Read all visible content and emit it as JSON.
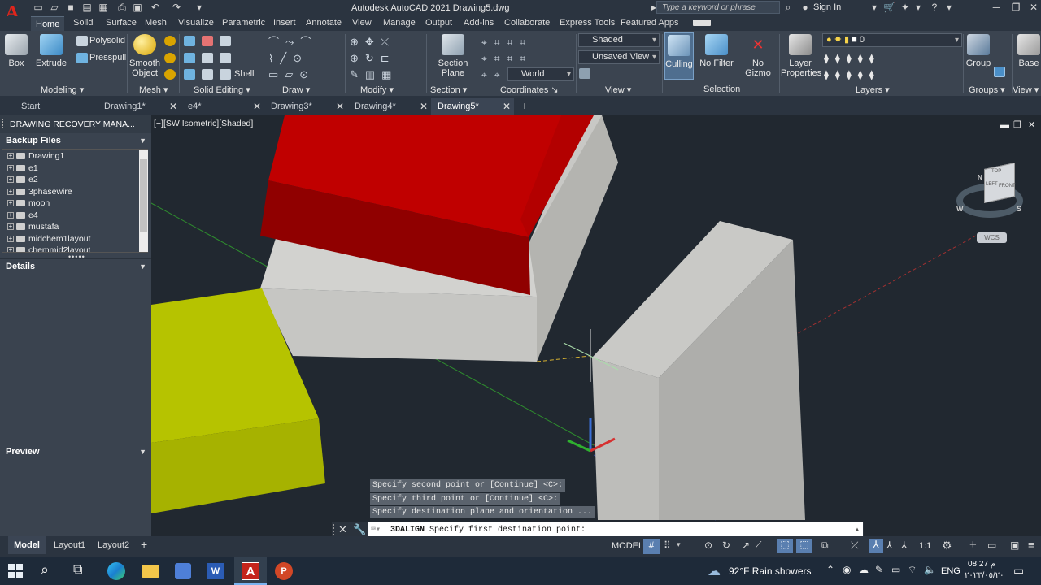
{
  "colors": {
    "accent": "#e0251c",
    "viewport_bg": "#212830",
    "ribbon_bg": "#3b4450",
    "red_box": "#b00000",
    "yellow_box": "#b5bf00",
    "grey_box": "#c5c5c2"
  },
  "titlebar": {
    "title": "Autodesk AutoCAD 2021    Drawing5.dwg",
    "search_placeholder": "Type a keyword or phrase",
    "sign_in": "Sign In"
  },
  "ribbon_tabs": [
    "Home",
    "Solid",
    "Surface",
    "Mesh",
    "Visualize",
    "Parametric",
    "Insert",
    "Annotate",
    "View",
    "Manage",
    "Output",
    "Add-ins",
    "Collaborate",
    "Express Tools",
    "Featured Apps"
  ],
  "ribbon": {
    "box": "Box",
    "extrude": "Extrude",
    "polysolid": "Polysolid",
    "presspull": "Presspull",
    "smooth_object_1": "Smooth",
    "smooth_object_2": "Object",
    "shell": "Shell",
    "section_plane_1": "Section",
    "section_plane_2": "Plane",
    "visual_style": "Shaded",
    "view_state": "Unsaved View",
    "ucs": "World",
    "culling": "Culling",
    "no_filter": "No Filter",
    "no_gizmo_1": "No",
    "no_gizmo_2": "Gizmo",
    "layer_properties_1": "Layer",
    "layer_properties_2": "Properties",
    "layer_value": "0",
    "group": "Group",
    "base": "Base",
    "panels": {
      "modeling": "Modeling",
      "mesh": "Mesh",
      "solid_editing": "Solid Editing",
      "draw": "Draw",
      "modify": "Modify",
      "section": "Section",
      "coordinates": "Coordinates",
      "view": "View",
      "selection": "Selection",
      "layers": "Layers",
      "groups": "Groups",
      "view2": "View"
    }
  },
  "doc_tabs": [
    {
      "label": "Start"
    },
    {
      "label": "Drawing1*"
    },
    {
      "label": "e4*"
    },
    {
      "label": "Drawing3*"
    },
    {
      "label": "Drawing4*"
    },
    {
      "label": "Drawing5*"
    }
  ],
  "palette": {
    "title": "DRAWING RECOVERY MANA...",
    "backup_files": "Backup Files",
    "files": [
      "Drawing1",
      "e1",
      "e2",
      "3phasewire",
      "moon",
      "e4",
      "mustafa",
      "midchem1layout",
      "chemmid2layout"
    ],
    "details": "Details",
    "preview": "Preview"
  },
  "viewport": {
    "label": "[−][SW Isometric][Shaded]",
    "viewcube": {
      "top": "TOP",
      "left": "LEFT",
      "front": "FRONT",
      "w": "W",
      "s": "S",
      "n": "N",
      "wcs": "WCS"
    }
  },
  "command": {
    "history": [
      "Specify second point or [Continue] <C>:",
      "Specify third point or [Continue] <C>:",
      " Specify destination plane and orientation ..."
    ],
    "current_cmd": "3DALIGN",
    "current_prompt": "Specify first destination point:"
  },
  "statusbar": {
    "layout_tabs": [
      "Model",
      "Layout1",
      "Layout2"
    ],
    "model_label": "MODEL",
    "scale": "1:1"
  },
  "taskbar": {
    "weather": "92°F  Rain showers",
    "lang": "ENG",
    "time": "08:27 م",
    "date": "٢٠٢٣/٠٥/٢٠"
  }
}
